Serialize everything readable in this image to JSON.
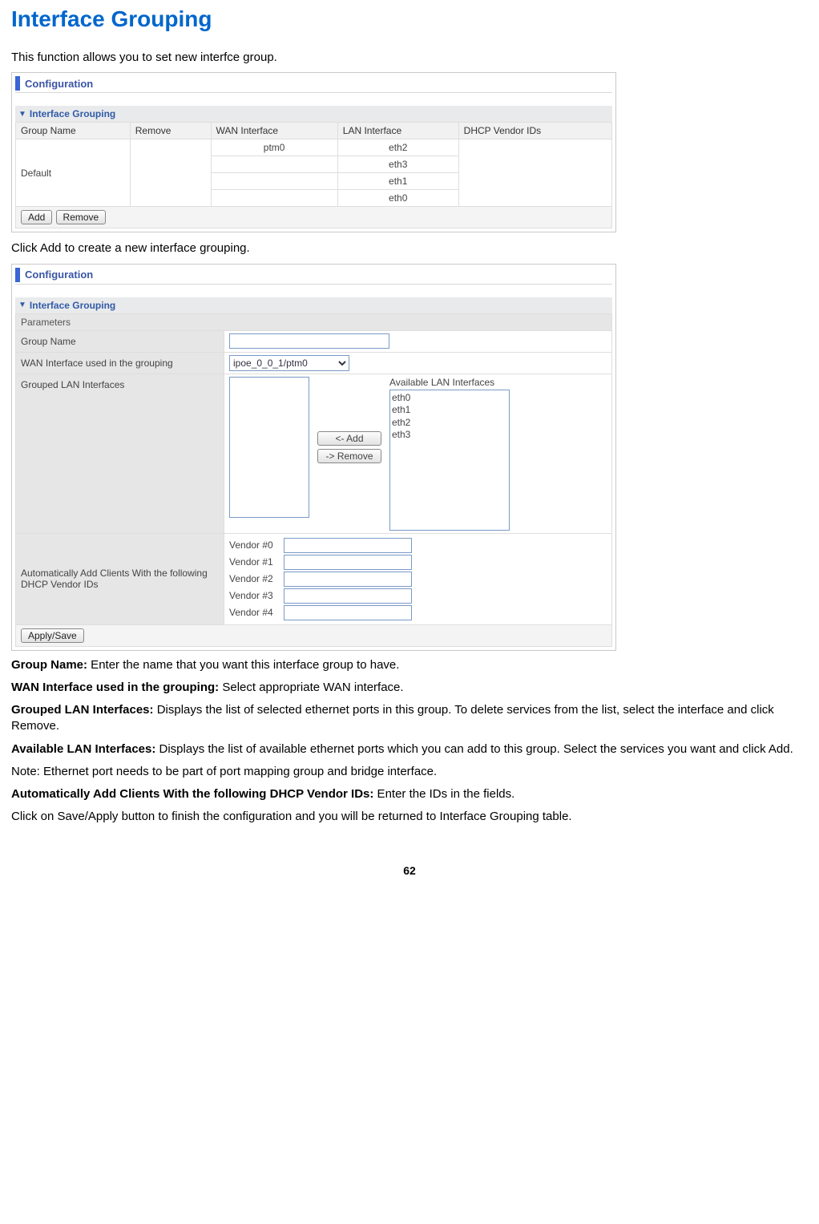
{
  "pageTitle": "Interface Grouping",
  "introText": "This function allows you to set new interfce group.",
  "panel1": {
    "configLabel": "Configuration",
    "sectionTitle": "Interface Grouping",
    "headers": {
      "groupName": "Group Name",
      "remove": "Remove",
      "wan": "WAN Interface",
      "lan": "LAN Interface",
      "vendor": "DHCP Vendor IDs"
    },
    "row1": {
      "groupName": "Default",
      "wan": "ptm0"
    },
    "lanRows": {
      "l0": "eth2",
      "l1": "eth3",
      "l2": "eth1",
      "l3": "eth0"
    },
    "btnAdd": "Add",
    "btnRemove": "Remove"
  },
  "midText": "Click Add to create a new interface grouping.",
  "panel2": {
    "configLabel": "Configuration",
    "sectionTitle": "Interface Grouping",
    "paramsHeader": "Parameters",
    "labels": {
      "groupName": "Group Name",
      "wanUsed": "WAN Interface used in the grouping",
      "groupedLan": "Grouped LAN Interfaces",
      "availLan": "Available LAN Interfaces",
      "autoAdd": "Automatically Add Clients With the following DHCP Vendor IDs"
    },
    "wanSelected": "ipoe_0_0_1/ptm0",
    "btnAddTransfer": "<- Add",
    "btnRemoveTransfer": "-> Remove",
    "availItems": {
      "a0": "eth0",
      "a1": "eth1",
      "a2": "eth2",
      "a3": "eth3"
    },
    "vendors": {
      "v0": "Vendor #0",
      "v1": "Vendor #1",
      "v2": "Vendor #2",
      "v3": "Vendor #3",
      "v4": "Vendor #4"
    },
    "btnApply": "Apply/Save"
  },
  "desc": {
    "p1a": "Group Name:",
    "p1b": " Enter the name that you want this interface group to have.",
    "p2a": "WAN Interface used in the grouping:",
    "p2b": " Select appropriate WAN interface.",
    "p3a": "Grouped LAN Interfaces:",
    "p3b": " Displays the list of selected ethernet ports in this group. To delete services from the list, select the interface and click Remove.",
    "p4a": "Available LAN Interfaces:",
    "p4b": " Displays the list of available ethernet ports which you can add to this group. Select the services you want and click Add.",
    "p5": "Note: Ethernet port needs to be part of port mapping group and bridge interface.",
    "p6a": "Automatically Add Clients With the following DHCP Vendor IDs:",
    "p6b": " Enter the IDs in the fields.",
    "p7": "Click on Save/Apply button to finish the configuration and you will be returned to Interface Grouping table."
  },
  "pageNum": "62"
}
